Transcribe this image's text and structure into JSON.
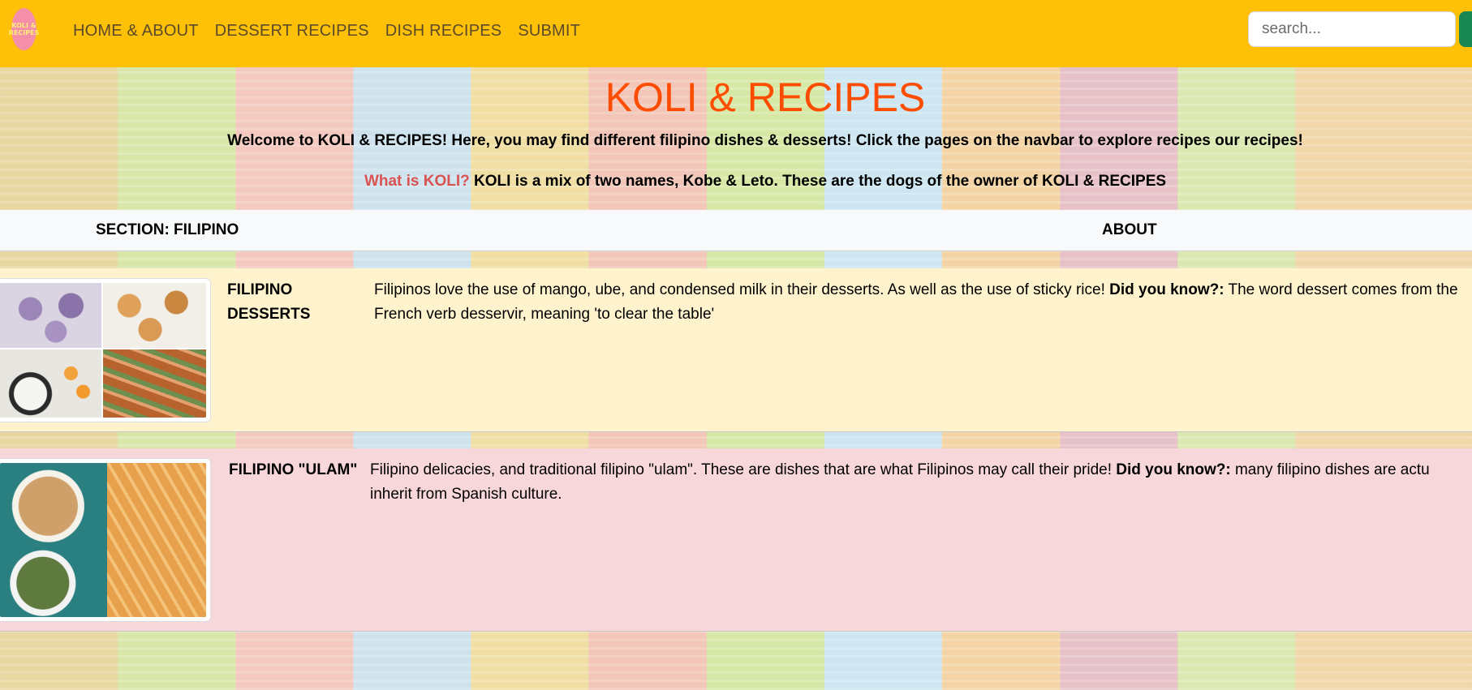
{
  "navbar": {
    "logo_text": "KOLI & RECIPES",
    "links": [
      "HOME & ABOUT",
      "DESSERT RECIPES",
      "DISH RECIPES",
      "SUBMIT"
    ],
    "search_placeholder": "search...",
    "colors": {
      "background": "#ffc107",
      "search_button": "#198754"
    }
  },
  "hero": {
    "title": "KOLI & RECIPES",
    "welcome": "Welcome to KOLI & RECIPES! Here, you may find different filipino dishes & desserts! Click the pages on the navbar to explore recipes our recipes!",
    "koli_question": "What is KOLI?",
    "koli_answer": " KOLI is a mix of two names, Kobe & Leto. These are the dogs of the owner of KOLI & RECIPES",
    "colors": {
      "title": "#ff4d00",
      "question": "#d9534f"
    }
  },
  "table": {
    "headers": {
      "section": "SECTION: FILIPINO",
      "about": "ABOUT"
    },
    "rows": [
      {
        "name": "FILIPINO DESSERTS",
        "text_before": "Filipinos love the use of mango, ube, and condensed milk in their desserts. As well as the use of sticky rice! ",
        "did_you_know": "Did you know?:",
        "text_after": " The word dessert comes from the French verb desservir, meaning 'to clear the table'",
        "background": "#fff3cd",
        "image": "desserts-collage-image"
      },
      {
        "name": "FILIPINO \"ULAM\"",
        "text_before": "Filipino delicacies, and traditional filipino \"ulam\". These are dishes that are what Filipinos may call their pride! ",
        "did_you_know": "Did you know?:",
        "text_after": " many filipino dishes are actu inherit from Spanish culture.",
        "background": "#f8d7da",
        "image": "ulam-collage-image"
      }
    ]
  }
}
